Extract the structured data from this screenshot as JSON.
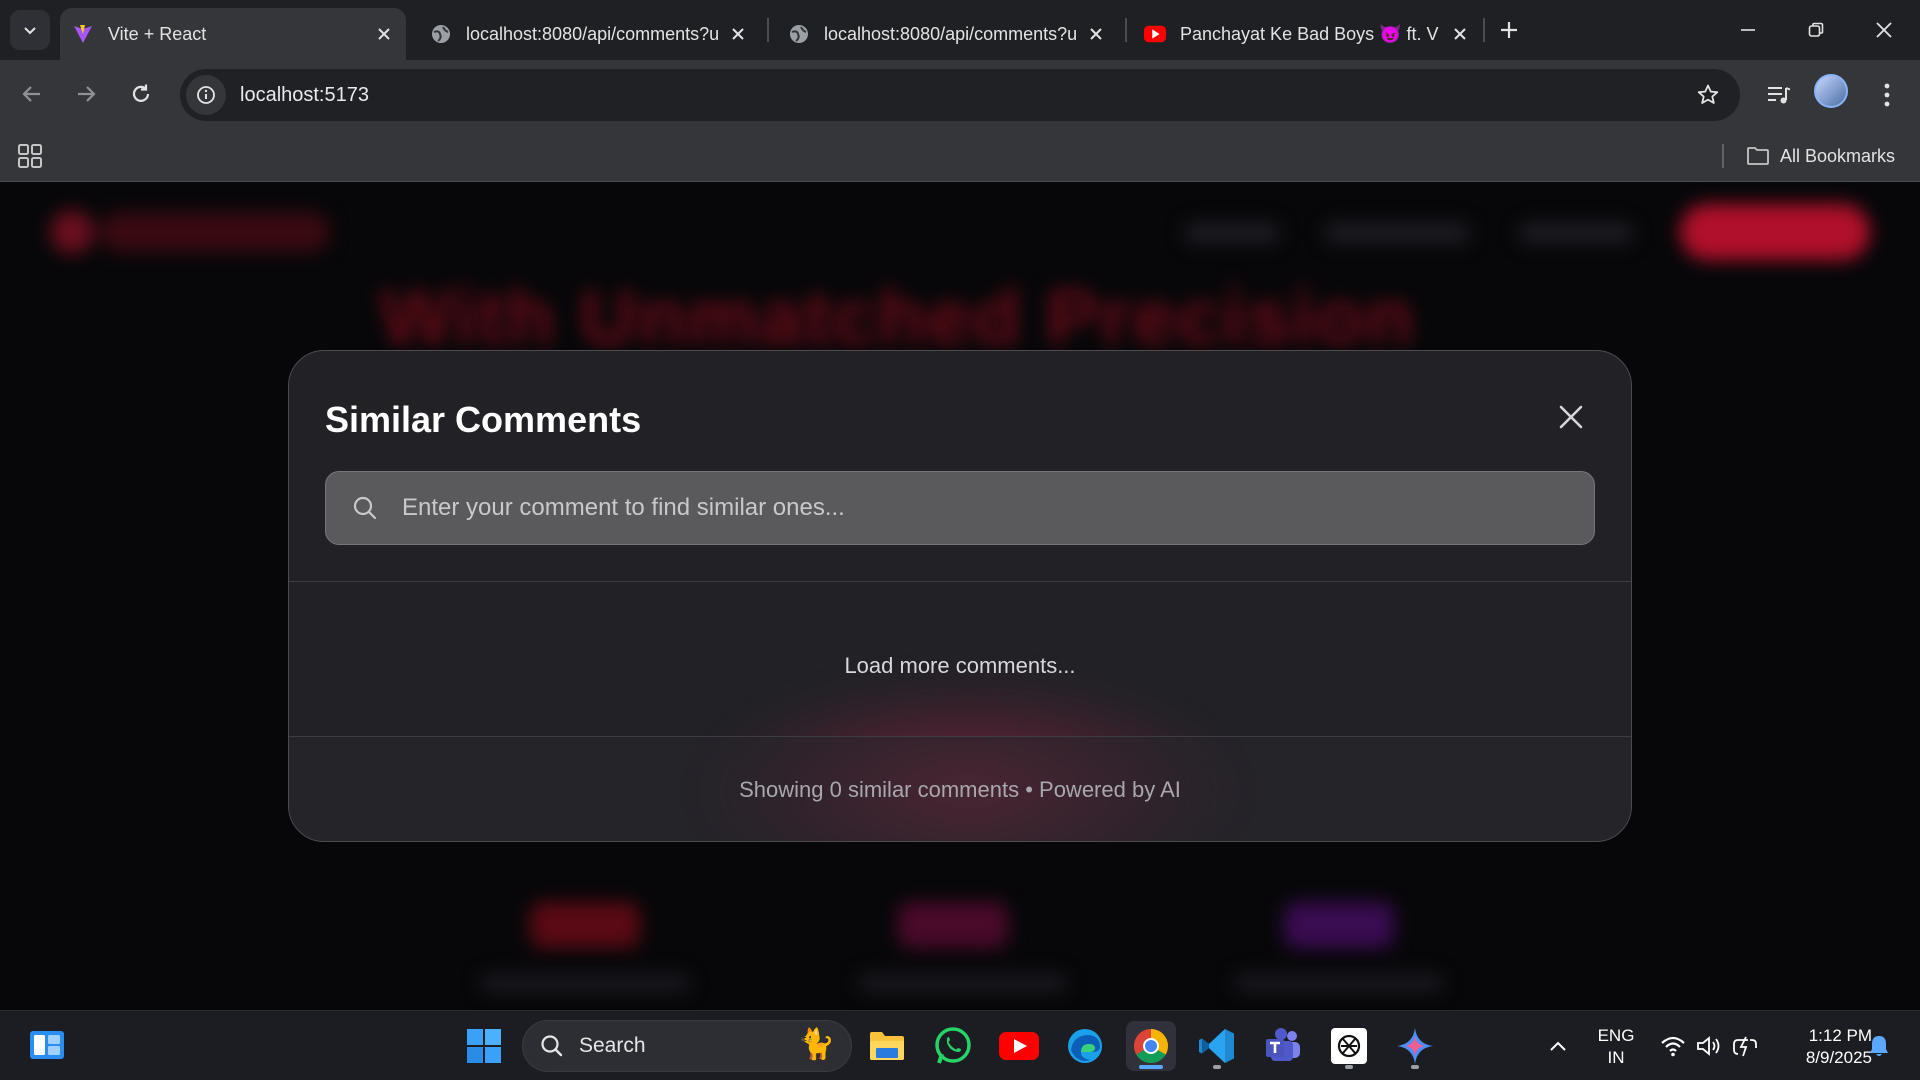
{
  "browser": {
    "tabs": [
      {
        "title": "Vite + React",
        "active": true,
        "icon": "vite-icon"
      },
      {
        "title": "localhost:8080/api/comments?u",
        "active": false,
        "icon": "globe-icon"
      },
      {
        "title": "localhost:8080/api/comments?u",
        "active": false,
        "icon": "globe-icon"
      },
      {
        "title": "Panchayat Ke Bad Boys 😈 ft. V",
        "active": false,
        "icon": "youtube-icon"
      }
    ],
    "url": "localhost:5173",
    "bookmarks_label": "All Bookmarks"
  },
  "modal": {
    "title": "Similar Comments",
    "search_placeholder": "Enter your comment to find similar ones...",
    "search_value": "",
    "load_more": "Load more comments...",
    "footer": "Showing 0 similar comments • Powered by AI",
    "similar_count": 0
  },
  "background_page": {
    "headline": "With Unmatched Precision"
  },
  "taskbar": {
    "search_label": "Search",
    "apps": [
      "file-explorer-icon",
      "whatsapp-icon",
      "youtube-icon",
      "edge-icon",
      "chrome-icon",
      "vscode-icon",
      "teams-icon",
      "chatgpt-icon",
      "gemini-icon"
    ],
    "language": {
      "line1": "ENG",
      "line2": "IN"
    },
    "time": "1:12 PM",
    "date": "8/9/2025"
  },
  "colors": {
    "accent": "#e11d48",
    "modal_bg": "#222226",
    "chrome_bg": "#35363a"
  }
}
